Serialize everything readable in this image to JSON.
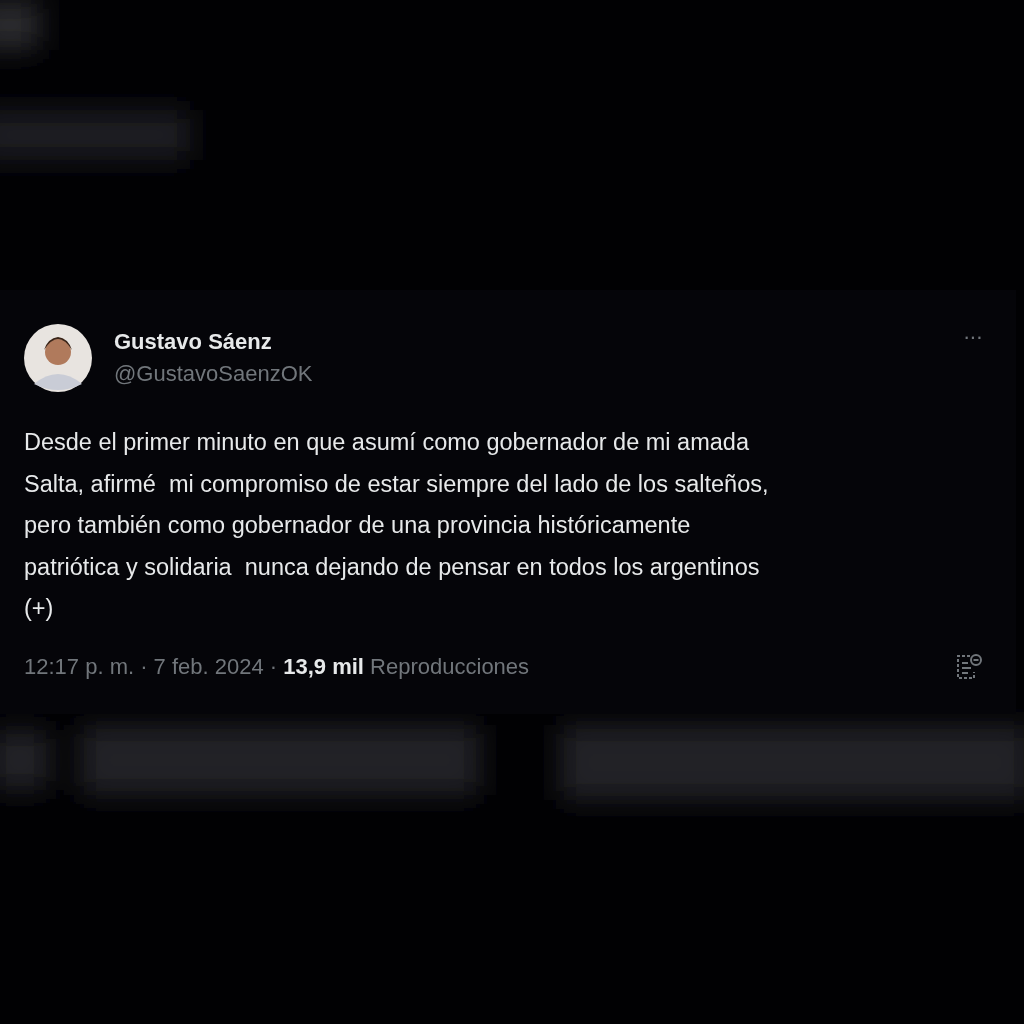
{
  "tweet": {
    "author_name": "Gustavo Sáenz",
    "handle": "@GustavoSaenzOK",
    "more": "···",
    "body": "Desde el primer minuto en que asumí como gobernador de mi amada\nSalta, afirmé  mi compromiso de estar siempre del lado de los salteños,\npero también como gobernador de una provincia históricamente\npatriótica y solidaria  nunca dejando de pensar en todos los argentinos\n(+)",
    "time": "12:17 p. m. · 7 feb. 2024 · ",
    "views_count": "13,9 mil",
    "views_label": " Reproducciones"
  }
}
